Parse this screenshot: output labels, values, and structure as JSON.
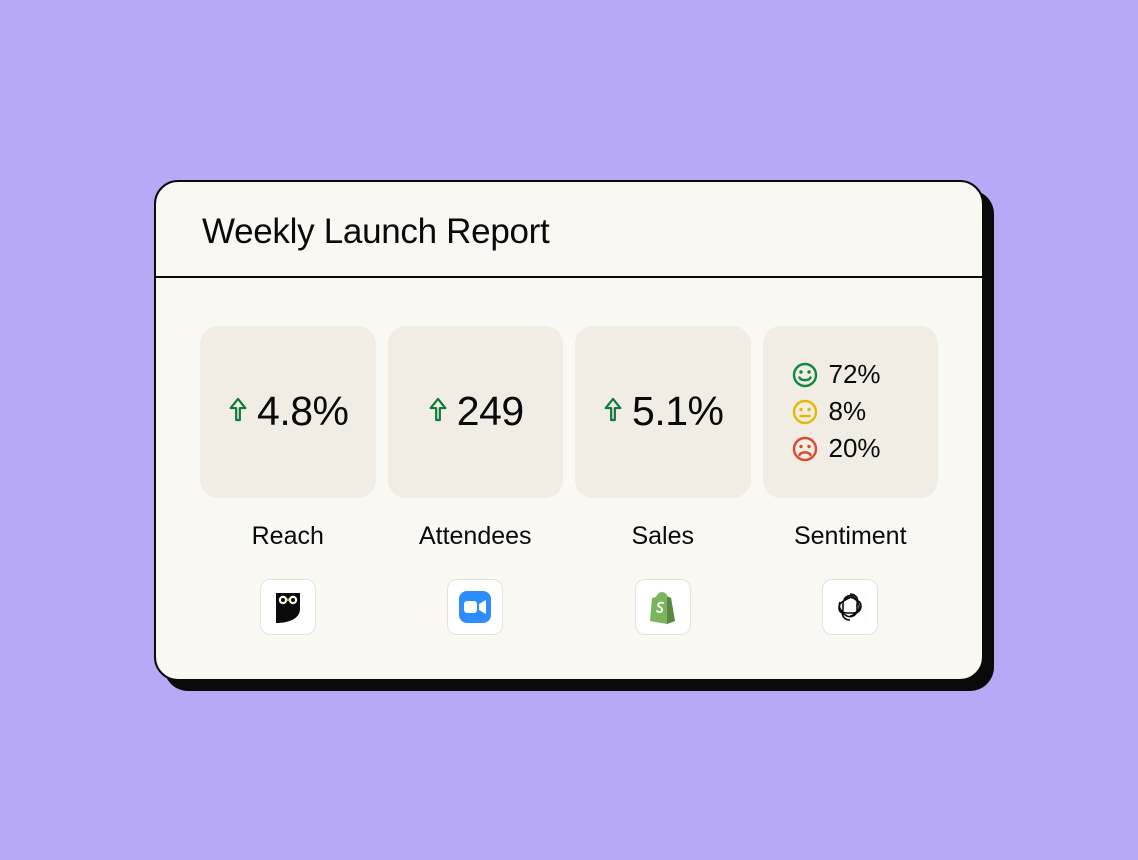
{
  "report": {
    "title": "Weekly Launch Report",
    "metrics": [
      {
        "label": "Reach",
        "value": "4.8%",
        "trend": "up",
        "source_icon": "hootsuite"
      },
      {
        "label": "Attendees",
        "value": "249",
        "trend": "up",
        "source_icon": "zoom"
      },
      {
        "label": "Sales",
        "value": "5.1%",
        "trend": "up",
        "source_icon": "shopify"
      },
      {
        "label": "Sentiment",
        "sentiment": {
          "positive": "72%",
          "neutral": "8%",
          "negative": "20%"
        },
        "source_icon": "openai"
      }
    ]
  },
  "colors": {
    "trend_up": "#0d7a3e",
    "face_positive": "#0d8a3e",
    "face_neutral": "#e6b800",
    "face_negative": "#d84a2e"
  }
}
